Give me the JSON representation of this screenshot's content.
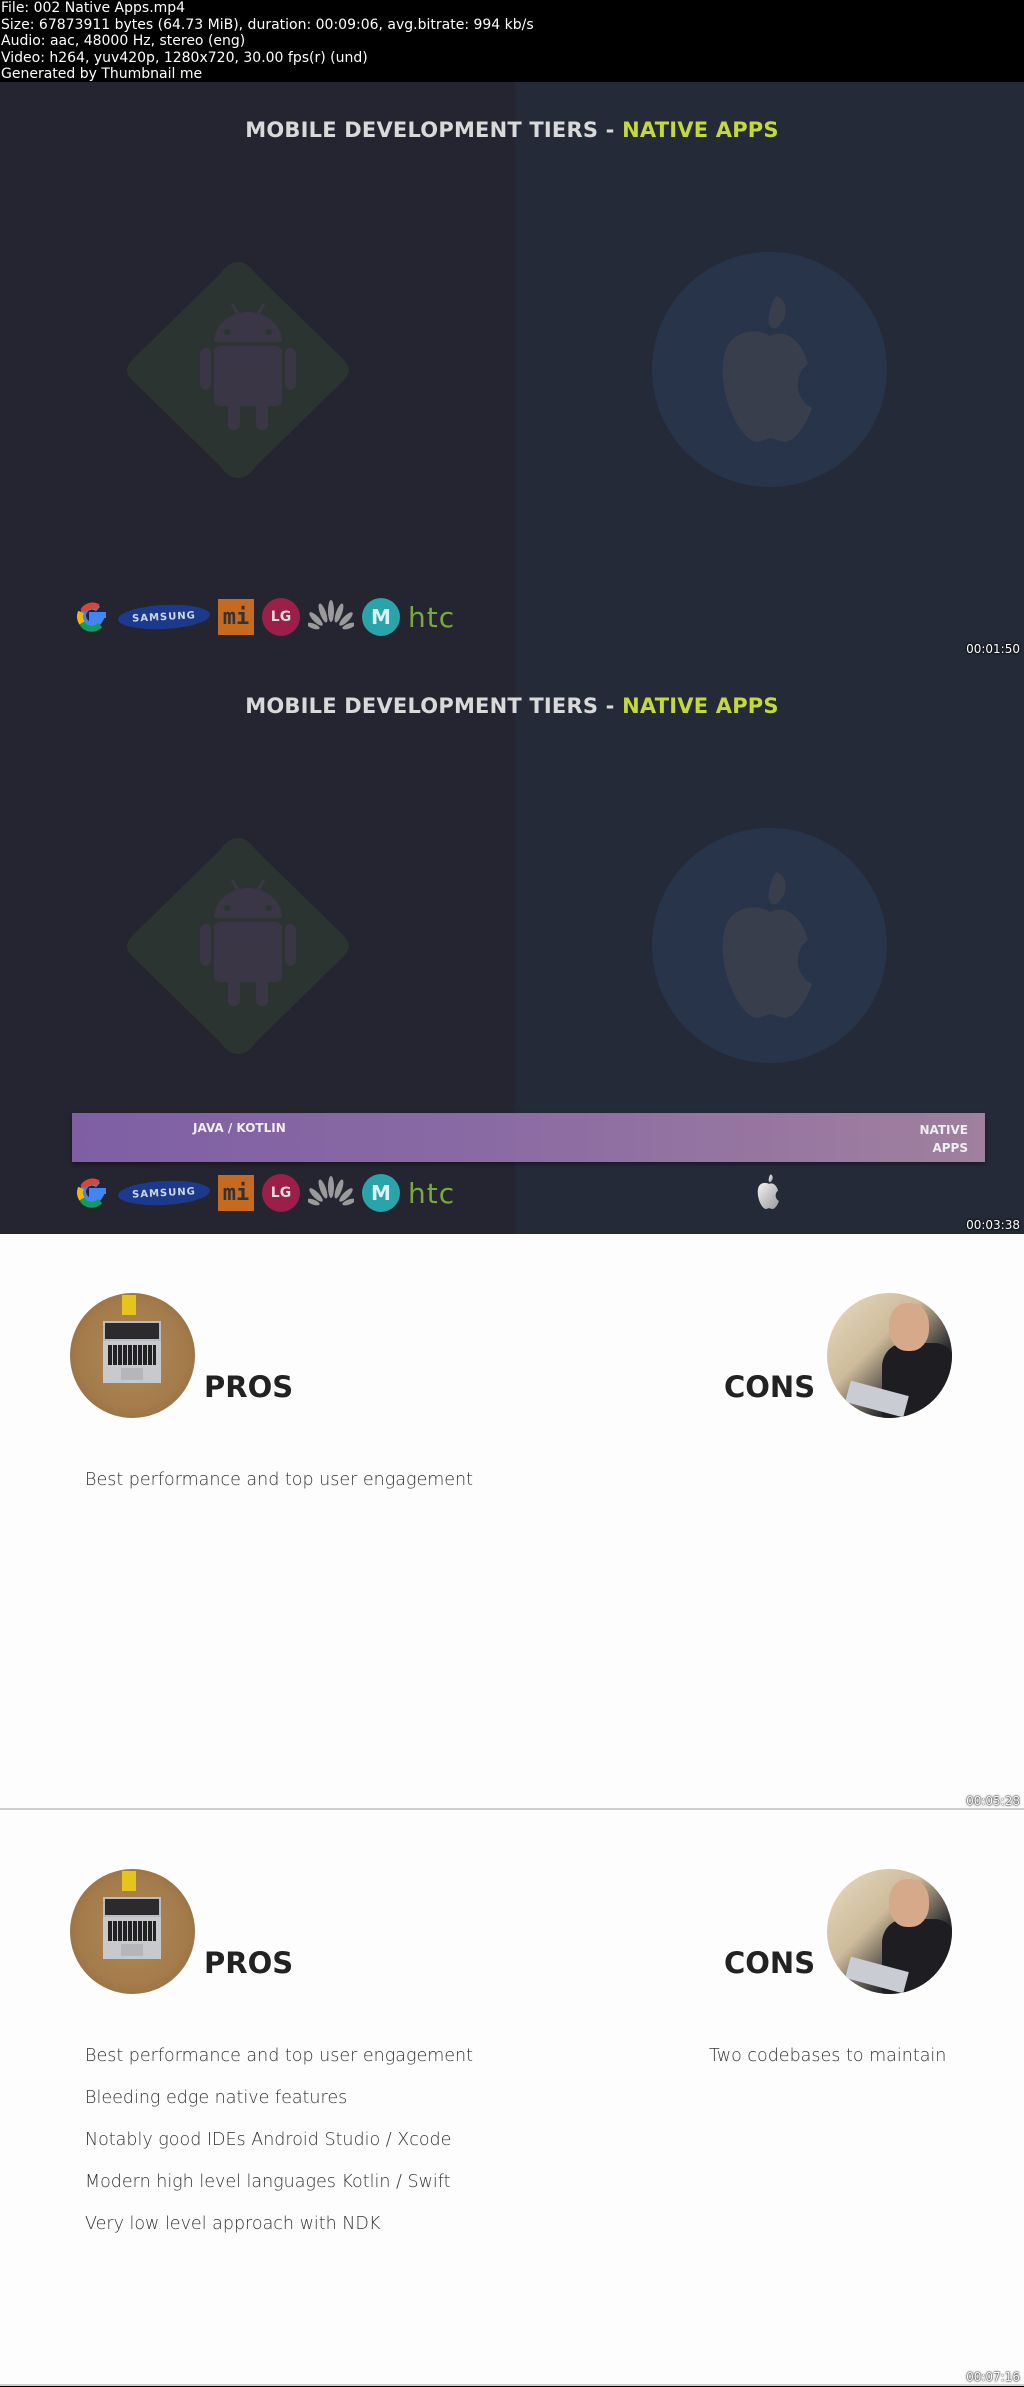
{
  "file_info": {
    "lines": [
      "File: 002 Native Apps.mp4",
      "Size: 67873911 bytes (64.73 MiB), duration: 00:09:06, avg.bitrate: 994 kb/s",
      "Audio: aac, 48000 Hz, stereo (eng)",
      "Video: h264, yuv420p, 1280x720, 30.00 fps(r) (und)",
      "Generated by Thumbnail me"
    ]
  },
  "frames": [
    {
      "timestamp": "00:01:50",
      "title_main": "MOBILE DEVELOPMENT TIERS - ",
      "title_accent": "NATIVE APPS",
      "android_logos": [
        "google-logo",
        "samsung-logo",
        "xiaomi-logo",
        "lg-logo",
        "huawei-logo",
        "motorola-logo",
        "htc-logo"
      ],
      "logo_text": {
        "samsung": "SAMSUNG",
        "mi": "mi",
        "lg": "LG",
        "moto": "M",
        "htc": "htc"
      }
    },
    {
      "timestamp": "00:03:38",
      "title_main": "MOBILE DEVELOPMENT TIERS - ",
      "title_accent": "NATIVE APPS",
      "bar_left_label": "JAVA / KOTLIN",
      "bar_right_label": "NATIVE APPS",
      "logo_text": {
        "samsung": "SAMSUNG",
        "mi": "mi",
        "lg": "LG",
        "moto": "M",
        "htc": "htc"
      }
    },
    {
      "timestamp": "00:05:28",
      "pros_heading": "PROS",
      "cons_heading": "CONS",
      "pros": [
        "Best performance and top user engagement"
      ],
      "cons": []
    },
    {
      "timestamp": "00:07:16",
      "pros_heading": "PROS",
      "cons_heading": "CONS",
      "pros": [
        "Best performance and top user engagement",
        "Bleeding edge native features",
        "Notably good IDEs Android Studio / Xcode",
        "Modern high level languages Kotlin / Swift",
        "Very low level approach with NDK"
      ],
      "cons": [
        "Two codebases to maintain"
      ]
    }
  ],
  "colors": {
    "title_accent": "#c4d93a",
    "dark_left": "#242531",
    "dark_right": "#242a38",
    "bar_start": "#7e5fa4",
    "bar_end": "#a0809e"
  }
}
